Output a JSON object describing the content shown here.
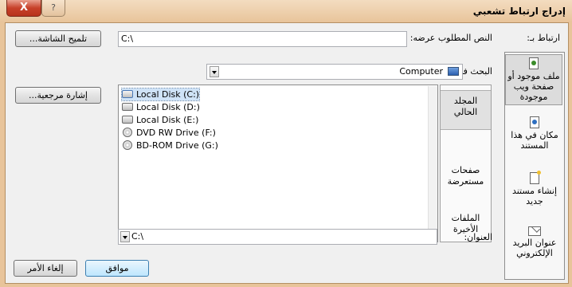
{
  "window": {
    "title": "إدراج ارتباط تشعبي",
    "close_glyph": "X",
    "help_glyph": "?"
  },
  "link_to": {
    "label": "ارتباط بـ:",
    "items": [
      {
        "line1": "ملف موجود أو",
        "line2": "صفحة ويب",
        "line3": "موجودة",
        "selected": true,
        "icon": "existing-file-icon"
      },
      {
        "line1": "مكان في هذا",
        "line2": "المستند",
        "icon": "place-in-document-icon"
      },
      {
        "line1": "إنشاء مستند",
        "line2": "جديد",
        "icon": "new-document-icon"
      },
      {
        "line1": "عنوان البريد",
        "line2": "الإلكتروني",
        "icon": "email-address-icon"
      }
    ]
  },
  "text_to_display": {
    "label": "النص المطلوب عرضه:",
    "value": "C:\\"
  },
  "screentip_button": "تلميح الشاشة...",
  "look_in": {
    "label": "البحث في:",
    "value": "Computer",
    "icon": "computer-icon"
  },
  "toolbar_icons": [
    "up-folder-icon",
    "browse-web-icon",
    "browse-file-icon"
  ],
  "bookmark_button": "إشارة مرجعية...",
  "tabs": [
    {
      "line1": "المجلد",
      "line2": "الحالي",
      "active": true
    },
    {
      "line1": "صفحات",
      "line2": "مستعرضة"
    },
    {
      "line1": "الملفات",
      "line2": "الأخيرة"
    }
  ],
  "files": [
    {
      "name": "Local Disk (C:)",
      "icon": "os-drive-icon"
    },
    {
      "name": "Local Disk (D:)",
      "icon": "hard-drive-icon"
    },
    {
      "name": "Local Disk (E:)",
      "icon": "hard-drive-icon"
    },
    {
      "name": "DVD RW Drive (F:)",
      "icon": "dvd-drive-icon"
    },
    {
      "name": "BD-ROM Drive (G:)",
      "icon": "bd-drive-icon"
    }
  ],
  "address": {
    "label": "العنوان:",
    "value": "C:\\"
  },
  "ok_button": "موافق",
  "cancel_button": "إلغاء الأمر"
}
